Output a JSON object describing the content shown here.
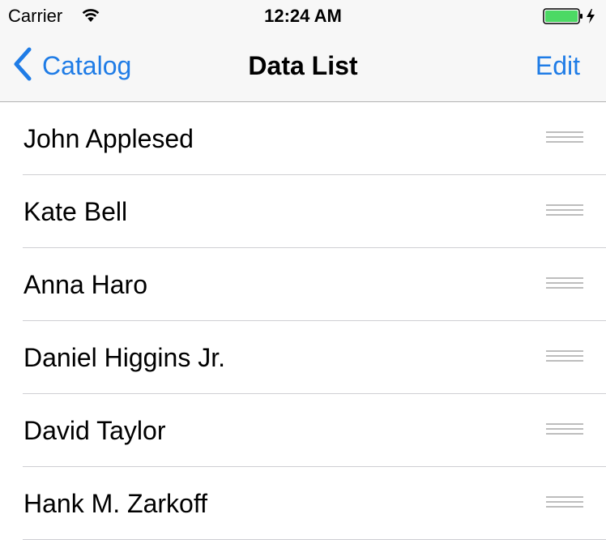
{
  "status_bar": {
    "carrier": "Carrier",
    "time": "12:24 AM",
    "battery_color": "#4cd964"
  },
  "nav_bar": {
    "back_label": "Catalog",
    "title": "Data List",
    "edit_label": "Edit",
    "accent_color": "#1f7ce6"
  },
  "list": {
    "items": [
      {
        "label": "John Applesed"
      },
      {
        "label": "Kate Bell"
      },
      {
        "label": "Anna Haro"
      },
      {
        "label": "Daniel Higgins Jr."
      },
      {
        "label": "David Taylor"
      },
      {
        "label": "Hank M. Zarkoff"
      }
    ]
  },
  "icons": {
    "wifi": "wifi-icon",
    "battery": "battery-icon",
    "back": "chevron-left-icon",
    "reorder": "reorder-icon"
  }
}
